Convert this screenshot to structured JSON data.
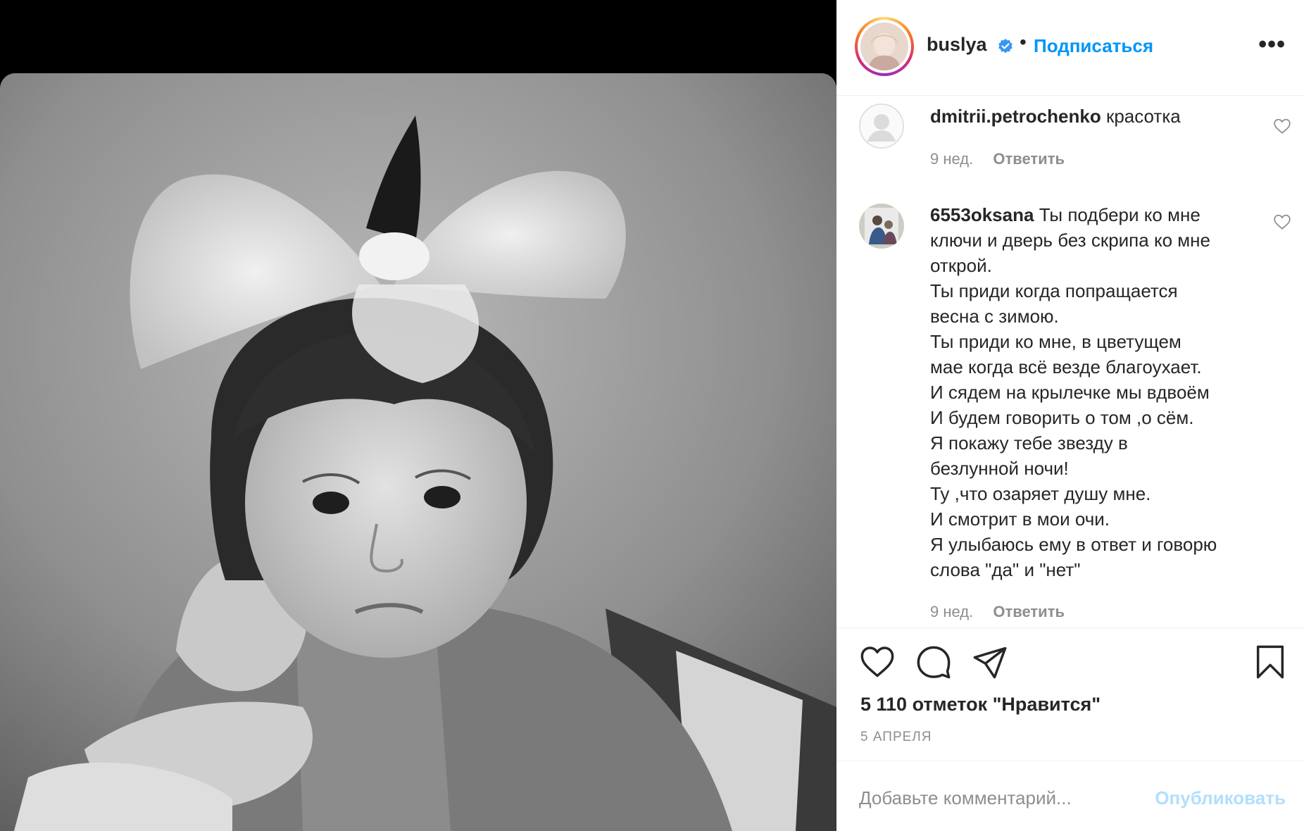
{
  "post": {
    "username": "buslya",
    "follow_label": "Подписаться",
    "more_label": "•••",
    "likes_text": "5 110 отметок \"Нравится\"",
    "date_text": "5 АПРЕЛЯ"
  },
  "comments": [
    {
      "user": "dmitrii.petrochenko",
      "lines": [
        "красотка"
      ],
      "time": "9 нед.",
      "reply": "Ответить"
    },
    {
      "user": "6553oksana",
      "lines": [
        "Ты подбери ко мне",
        "ключи и дверь без скрипа ко мне",
        "открой.",
        "Ты приди когда попращается",
        "весна с зимою.",
        "Ты приди ко мне, в цветущем",
        "мае когда всё везде благоухает.",
        "И сядем на крылечке мы вдвоём",
        "И будем говорить о том ,о сём.",
        "Я покажу тебе звезду в",
        "безлунной ночи!",
        "Ту ,что озаряет душу мне.",
        "И смотрит в мои очи.",
        "Я улыбаюсь ему в ответ и говорю",
        "слова \"да\" и \"нет\""
      ],
      "time": "9 нед.",
      "reply": "Ответить"
    }
  ],
  "add_comment": {
    "placeholder": "Добавьте комментарий...",
    "publish_label": "Опубликовать"
  },
  "colors": {
    "link_blue": "#0095f6",
    "publish_disabled": "#b2dffc",
    "muted": "#8e8e8e",
    "text": "#262626"
  }
}
